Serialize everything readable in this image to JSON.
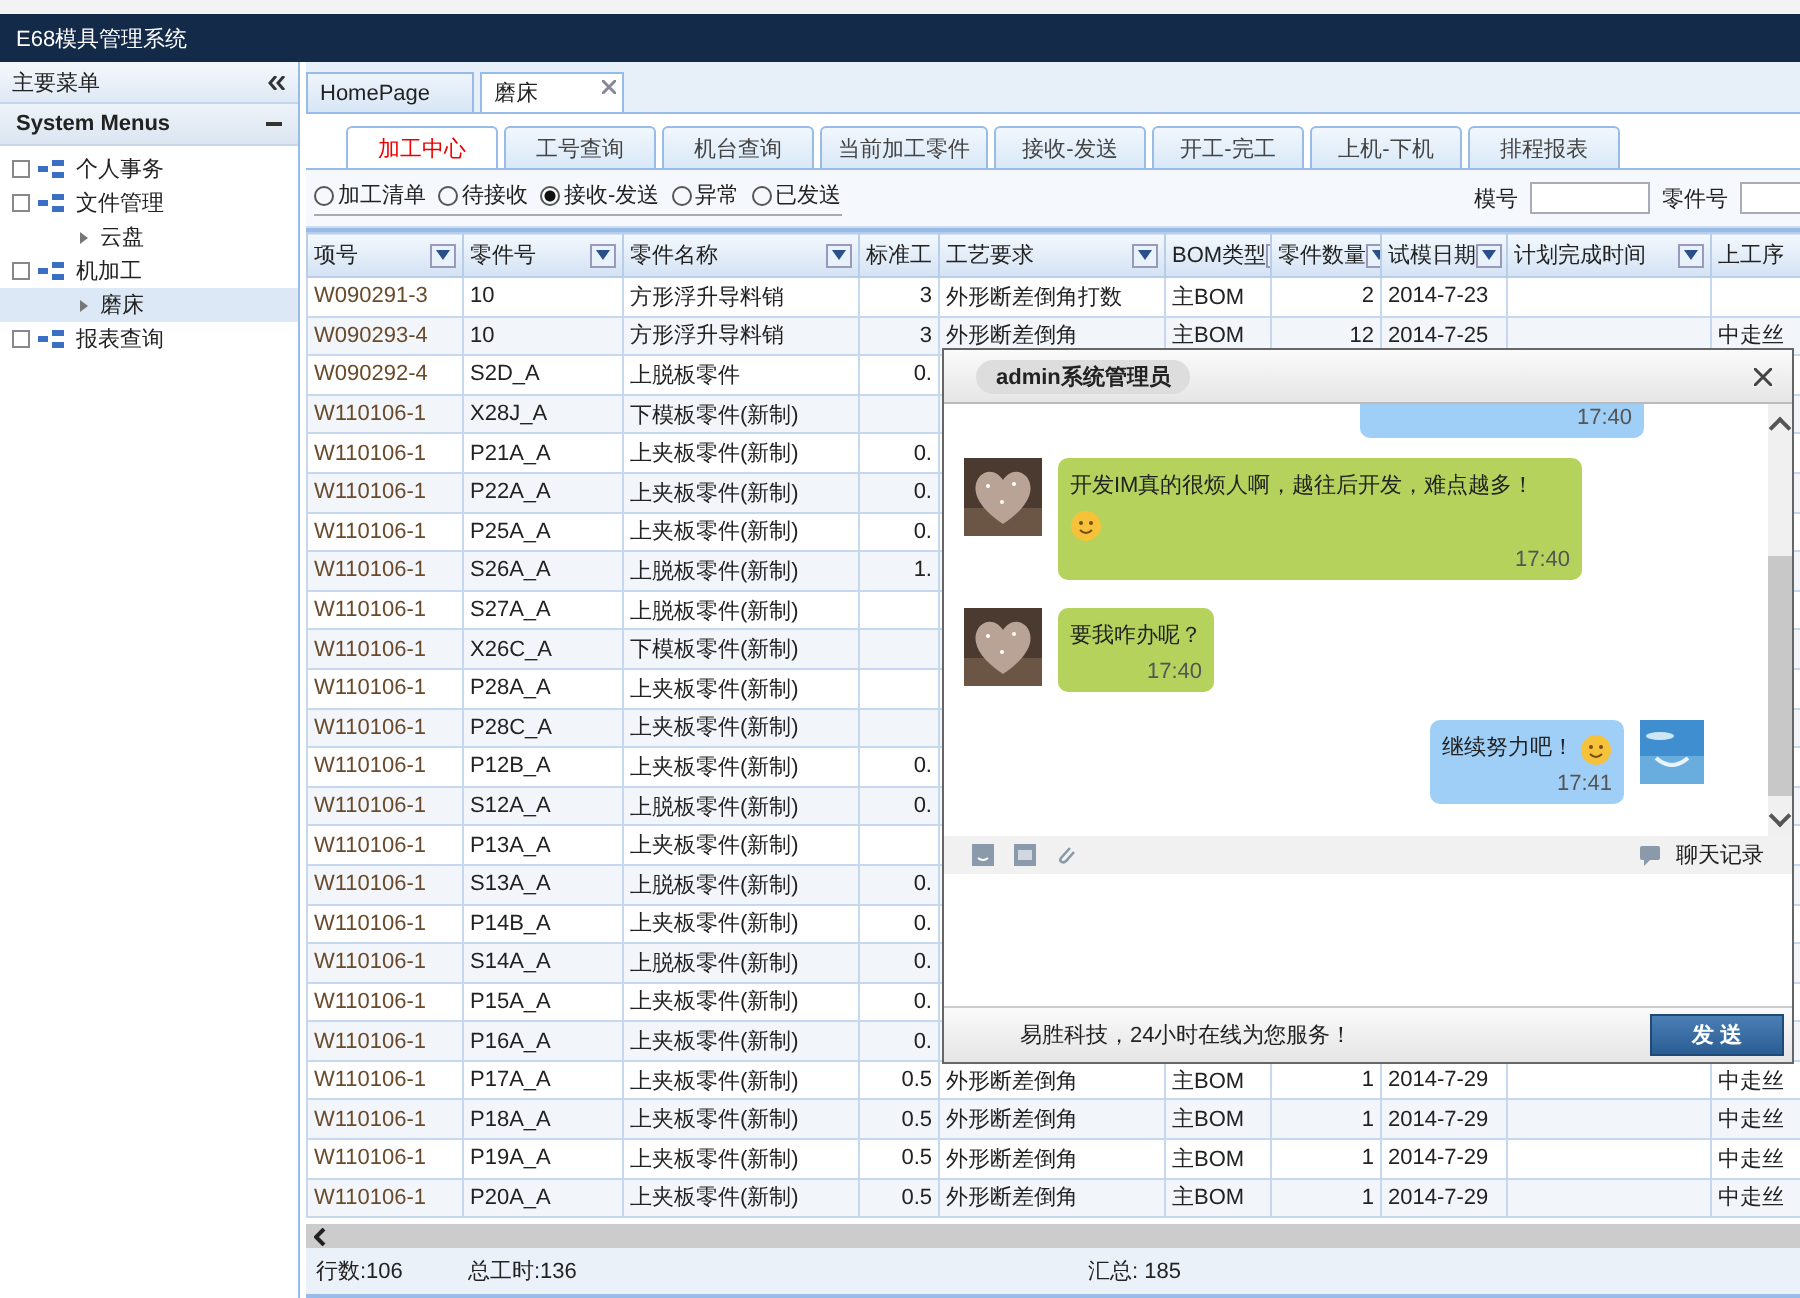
{
  "app_title": "E68模具管理系统",
  "sidebar": {
    "title": "主要菜单",
    "section": "System Menus",
    "tree": [
      {
        "label": "个人事务",
        "selected": false
      },
      {
        "label": "文件管理",
        "selected": false,
        "children": [
          {
            "label": "云盘",
            "selected": false
          }
        ]
      },
      {
        "label": "机加工",
        "selected": false,
        "children": [
          {
            "label": "磨床",
            "selected": true
          }
        ]
      },
      {
        "label": "报表查询",
        "selected": false
      }
    ]
  },
  "tabs": [
    {
      "label": "HomePage",
      "selected": false,
      "closable": false
    },
    {
      "label": "磨床",
      "selected": true,
      "closable": true
    }
  ],
  "subtabs": [
    {
      "label": "加工中心",
      "selected": true
    },
    {
      "label": "工号查询",
      "selected": false
    },
    {
      "label": "机台查询",
      "selected": false
    },
    {
      "label": "当前加工零件",
      "selected": false
    },
    {
      "label": "接收-发送",
      "selected": false
    },
    {
      "label": "开工-完工",
      "selected": false
    },
    {
      "label": "上机-下机",
      "selected": false
    },
    {
      "label": "排程报表",
      "selected": false
    }
  ],
  "filters": [
    {
      "label": "加工清单",
      "selected": false
    },
    {
      "label": "待接收",
      "selected": false
    },
    {
      "label": "接收-发送",
      "selected": true
    },
    {
      "label": "异常",
      "selected": false
    },
    {
      "label": "已发送",
      "selected": false
    }
  ],
  "search_fields": [
    {
      "label": "模号"
    },
    {
      "label": "零件号"
    }
  ],
  "table": {
    "columns": [
      "项号",
      "零件号",
      "零件名称",
      "标准工",
      "工艺要求",
      "BOM类型",
      "零件数量",
      "试模日期",
      "计划完成时间",
      "上工序"
    ],
    "rows": [
      {
        "cells": [
          "W090291-3",
          "10",
          "方形浮升导料销",
          "3",
          "外形断差倒角打数",
          "主BOM",
          "2",
          "2014-7-23",
          "",
          ""
        ]
      },
      {
        "cells": [
          "W090293-4",
          "10",
          "方形浮升导料销",
          "3",
          "外形断差倒角",
          "主BOM",
          "12",
          "2014-7-25",
          "",
          "中走丝"
        ]
      },
      {
        "cells": [
          "W090292-4",
          "S2D_A",
          "上脱板零件",
          "0."
        ]
      },
      {
        "cells": [
          "W110106-1",
          "X28J_A",
          "下模板零件(新制)",
          ""
        ]
      },
      {
        "cells": [
          "W110106-1",
          "P21A_A",
          "上夹板零件(新制)",
          "0."
        ]
      },
      {
        "cells": [
          "W110106-1",
          "P22A_A",
          "上夹板零件(新制)",
          "0."
        ]
      },
      {
        "cells": [
          "W110106-1",
          "P25A_A",
          "上夹板零件(新制)",
          "0."
        ]
      },
      {
        "cells": [
          "W110106-1",
          "S26A_A",
          "上脱板零件(新制)",
          "1."
        ]
      },
      {
        "cells": [
          "W110106-1",
          "S27A_A",
          "上脱板零件(新制)",
          ""
        ]
      },
      {
        "cells": [
          "W110106-1",
          "X26C_A",
          "下模板零件(新制)",
          ""
        ]
      },
      {
        "cells": [
          "W110106-1",
          "P28A_A",
          "上夹板零件(新制)",
          ""
        ]
      },
      {
        "cells": [
          "W110106-1",
          "P28C_A",
          "上夹板零件(新制)",
          ""
        ]
      },
      {
        "cells": [
          "W110106-1",
          "P12B_A",
          "上夹板零件(新制)",
          "0."
        ]
      },
      {
        "cells": [
          "W110106-1",
          "S12A_A",
          "上脱板零件(新制)",
          "0."
        ]
      },
      {
        "cells": [
          "W110106-1",
          "P13A_A",
          "上夹板零件(新制)",
          ""
        ]
      },
      {
        "cells": [
          "W110106-1",
          "S13A_A",
          "上脱板零件(新制)",
          "0."
        ]
      },
      {
        "cells": [
          "W110106-1",
          "P14B_A",
          "上夹板零件(新制)",
          "0."
        ]
      },
      {
        "cells": [
          "W110106-1",
          "S14A_A",
          "上脱板零件(新制)",
          "0."
        ]
      },
      {
        "cells": [
          "W110106-1",
          "P15A_A",
          "上夹板零件(新制)",
          "0."
        ]
      },
      {
        "cells": [
          "W110106-1",
          "P16A_A",
          "上夹板零件(新制)",
          "0."
        ]
      },
      {
        "cells": [
          "W110106-1",
          "P17A_A",
          "上夹板零件(新制)",
          "0.5",
          "外形断差倒角",
          "主BOM",
          "1",
          "2014-7-29",
          "",
          "中走丝"
        ]
      },
      {
        "cells": [
          "W110106-1",
          "P18A_A",
          "上夹板零件(新制)",
          "0.5",
          "外形断差倒角",
          "主BOM",
          "1",
          "2014-7-29",
          "",
          "中走丝"
        ]
      },
      {
        "cells": [
          "W110106-1",
          "P19A_A",
          "上夹板零件(新制)",
          "0.5",
          "外形断差倒角",
          "主BOM",
          "1",
          "2014-7-29",
          "",
          "中走丝"
        ]
      },
      {
        "cells": [
          "W110106-1",
          "P20A_A",
          "上夹板零件(新制)",
          "0.5",
          "外形断差倒角",
          "主BOM",
          "1",
          "2014-7-29",
          "",
          "中走丝"
        ]
      }
    ]
  },
  "footer": {
    "row_count": "行数:106",
    "total_hours": "总工时:136",
    "summary": "汇总: 185"
  },
  "chat": {
    "title": "admin系统管理员",
    "messages": [
      {
        "kind": "sent",
        "emoji": false,
        "time": "17:40"
      },
      {
        "kind": "received",
        "text": "开发IM真的很烦人啊，越往后开发，难点越多！",
        "emoji": true,
        "time": "17:40"
      },
      {
        "kind": "received",
        "text": "要我咋办呢？",
        "emoji": false,
        "time": "17:40"
      },
      {
        "kind": "sent",
        "text": "继续努力吧！",
        "emoji": true,
        "time": "17:41"
      }
    ],
    "history_label": "聊天记录",
    "slogan": "易胜科技，24小时在线为您服务！",
    "send_label": "发 送"
  }
}
